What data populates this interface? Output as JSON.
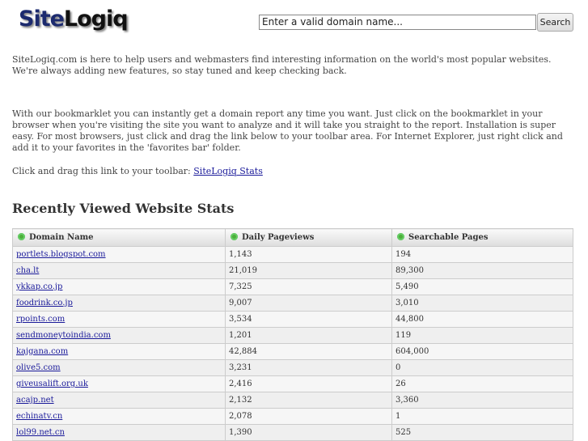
{
  "logo": {
    "part1": "Site",
    "part2": "Logiq"
  },
  "search": {
    "value": "Enter a valid domain name...",
    "button": "Search"
  },
  "intro": "SiteLogiq.com is here to help users and webmasters find interesting information on the world's most popular websites. We're always adding new features, so stay tuned and keep checking back.",
  "bookmarklet": "With our bookmarklet you can instantly get a domain report any time you want. Just click on the bookmarklet in your browser when you're visiting the site you want to analyze and it will take you straight to the report. Installation is super easy. For most browsers, just click and drag the link below to your toolbar area. For Internet Explorer, just right click and add it to your favorites in the 'favorites bar' folder.",
  "drag_label": "Click and drag this link to your toolbar: ",
  "drag_link": "SiteLogiq Stats",
  "heading": "Recently Viewed Website Stats",
  "table": {
    "headers": [
      "Domain Name",
      "Daily Pageviews",
      "Searchable Pages"
    ],
    "rows": [
      [
        "portlets.blogspot.com",
        "1,143",
        "194"
      ],
      [
        "cha.lt",
        "21,019",
        "89,300"
      ],
      [
        "ykkap.co.jp",
        "7,325",
        "5,490"
      ],
      [
        "foodrink.co.jp",
        "9,007",
        "3,010"
      ],
      [
        "rpoints.com",
        "3,534",
        "44,800"
      ],
      [
        "sendmoneytoindia.com",
        "1,201",
        "119"
      ],
      [
        "kajgana.com",
        "42,884",
        "604,000"
      ],
      [
        "olive5.com",
        "3,231",
        "0"
      ],
      [
        "giveusalift.org.uk",
        "2,416",
        "26"
      ],
      [
        "acajp.net",
        "2,132",
        "3,360"
      ],
      [
        "echinatv.cn",
        "2,078",
        "1"
      ],
      [
        "lol99.net.cn",
        "1,390",
        "525"
      ]
    ]
  }
}
